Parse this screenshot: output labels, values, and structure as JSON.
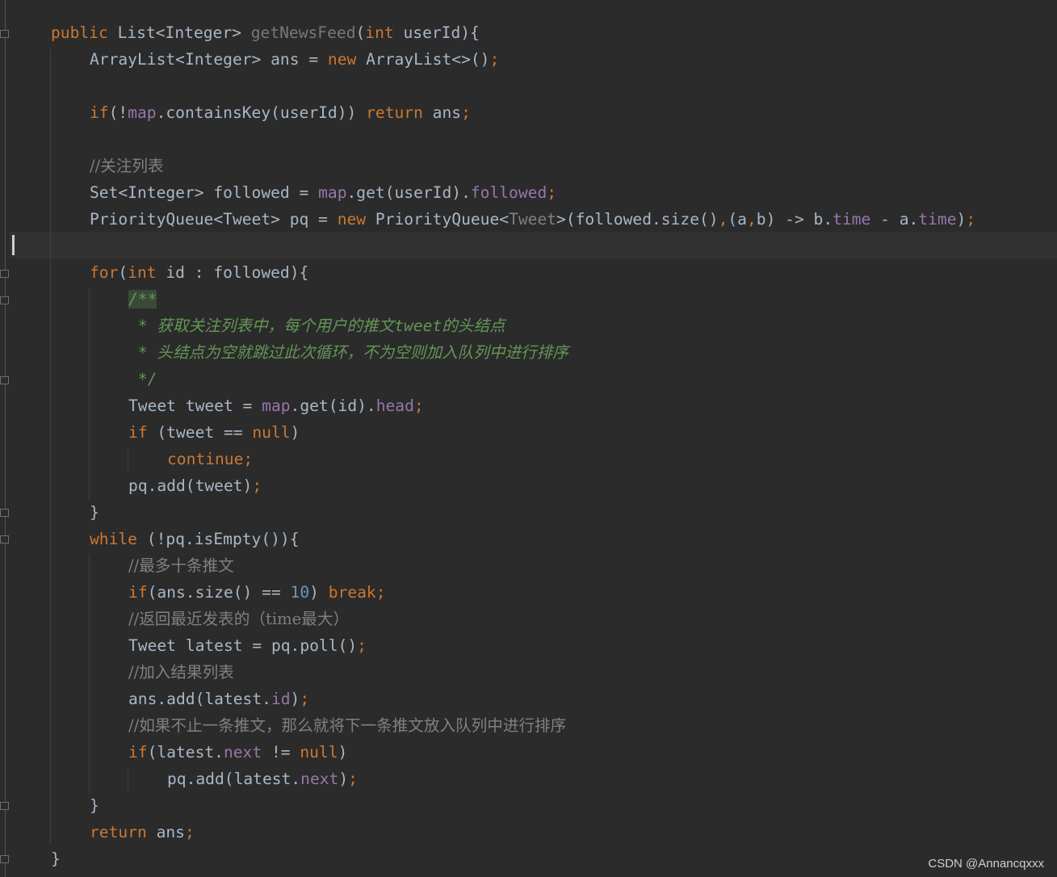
{
  "editor": {
    "method_signature": {
      "modifier": "public",
      "return_type": "List<Integer>",
      "method_name": "getNewsFeed",
      "open_paren": "(",
      "param_type": "int",
      "rest": " userId){"
    },
    "lines": {
      "l2": {
        "a": "ArrayList<Integer> ans = ",
        "kw": "new",
        "b": " ArrayList<>()",
        "semi": ";"
      },
      "l4": {
        "kw": "if",
        "a": "(!",
        "fld": "map",
        "b": ".containsKey(userId)) ",
        "kw2": "return",
        "c": " ans",
        "semi": ";"
      },
      "l6": {
        "comment": "//关注列表"
      },
      "l7": {
        "a": "Set<Integer> followed = ",
        "fld": "map",
        "b": ".get(userId).",
        "fld2": "followed",
        "semi": ";"
      },
      "l8": {
        "a": "PriorityQueue<Tweet> pq = ",
        "kw": "new",
        "b": " PriorityQueue<",
        "gen": "Tweet",
        "c": ">(followed.size()",
        "comma": ",",
        "d": "(a",
        "comma2": ",",
        "e": "b) -> b.",
        "fld": "time",
        "f": " - a.",
        "fld2": "time",
        "g": ")",
        "semi": ";"
      },
      "l10": {
        "kw": "for",
        "a": "(",
        "kw2": "int",
        "b": " id : followed){"
      },
      "l11": {
        "doc": "/**"
      },
      "l12": {
        "doc": " * 获取关注列表中，每个用户的推文tweet的头结点"
      },
      "l13": {
        "doc": " * 头结点为空就跳过此次循环，不为空则加入队列中进行排序"
      },
      "l14": {
        "doc": " */"
      },
      "l15": {
        "a": "Tweet tweet = ",
        "fld": "map",
        "b": ".get(id).",
        "fld2": "head",
        "semi": ";"
      },
      "l16": {
        "kw": "if",
        "a": " (tweet == ",
        "kw2": "null",
        "b": ")"
      },
      "l17": {
        "kw": "continue",
        "semi": ";"
      },
      "l18": {
        "a": "pq.add(tweet)",
        "semi": ";"
      },
      "l19": {
        "a": "}"
      },
      "l20": {
        "kw": "while",
        "a": " (!pq.isEmpty()){"
      },
      "l21": {
        "comment": "//最多十条推文"
      },
      "l22": {
        "kw": "if",
        "a": "(ans.size() == ",
        "num": "10",
        "b": ") ",
        "kw2": "break",
        "semi": ";"
      },
      "l23": {
        "comment": "//返回最近发表的（time最大）"
      },
      "l24": {
        "a": "Tweet latest = pq.poll()",
        "semi": ";"
      },
      "l25": {
        "comment": "//加入结果列表"
      },
      "l26": {
        "a": "ans.add(latest.",
        "fld": "id",
        "b": ")",
        "semi": ";"
      },
      "l27": {
        "comment": "//如果不止一条推文，那么就将下一条推文放入队列中进行排序"
      },
      "l28": {
        "kw": "if",
        "a": "(latest.",
        "fld": "next",
        "b": " != ",
        "kw2": "null",
        "c": ")"
      },
      "l29": {
        "a": "pq.add(latest.",
        "fld": "next",
        "b": ")",
        "semi": ";"
      },
      "l30": {
        "a": "}"
      },
      "l31": {
        "kw": "return",
        "a": " ans",
        "semi": ";"
      },
      "l32": {
        "a": "}"
      }
    }
  },
  "watermark": "CSDN @Annancqxxx",
  "colors": {
    "background": "#2b2b2b",
    "keyword": "#cc7832",
    "identifier": "#a9b7c6",
    "field": "#9876aa",
    "comment": "#808080",
    "doc_comment": "#629755",
    "number": "#6897bb"
  }
}
